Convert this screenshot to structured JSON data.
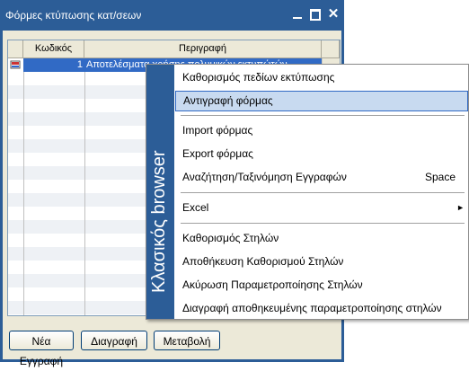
{
  "window": {
    "title": "Φόρμες κτύπωσης κατ/σεων",
    "close_glyph": "✕"
  },
  "grid": {
    "columns": [
      "Κωδικός",
      "Περιγραφή"
    ],
    "rows": [
      {
        "code": "1",
        "description": "Αποτελέσματα χρήσης πολυμικών εκτυπώτών"
      }
    ]
  },
  "buttons": {
    "new": "Νέα Εγγραφή",
    "delete": "Διαγραφή",
    "edit": "Μεταβολή"
  },
  "context_menu": {
    "strip_label": "Κλασικός browser",
    "items": [
      {
        "label": "Καθορισμός πεδίων εκτύπωσης"
      },
      {
        "label": "Αντιγραφή φόρμας",
        "selected": true
      },
      {
        "label": "Import φόρμας"
      },
      {
        "label": "Export φόρμας"
      },
      {
        "label": "Αναζήτηση/Ταξινόμηση Εγγραφών",
        "shortcut": "Space"
      },
      {
        "label": "Excel",
        "submenu_arrow": "►"
      },
      {
        "label": "Καθορισμός Στηλών"
      },
      {
        "label": "Αποθήκευση Καθορισμού Στηλών"
      },
      {
        "label": "Ακύρωση Παραμετροποίησης Στηλών"
      },
      {
        "label": "Διαγραφή αποθηκευμένης παραμετροποίησης στηλών"
      }
    ]
  },
  "colors": {
    "titlebar": "#2c5d97",
    "selection": "#316ac5",
    "menu_highlight": "#c8daf0"
  }
}
